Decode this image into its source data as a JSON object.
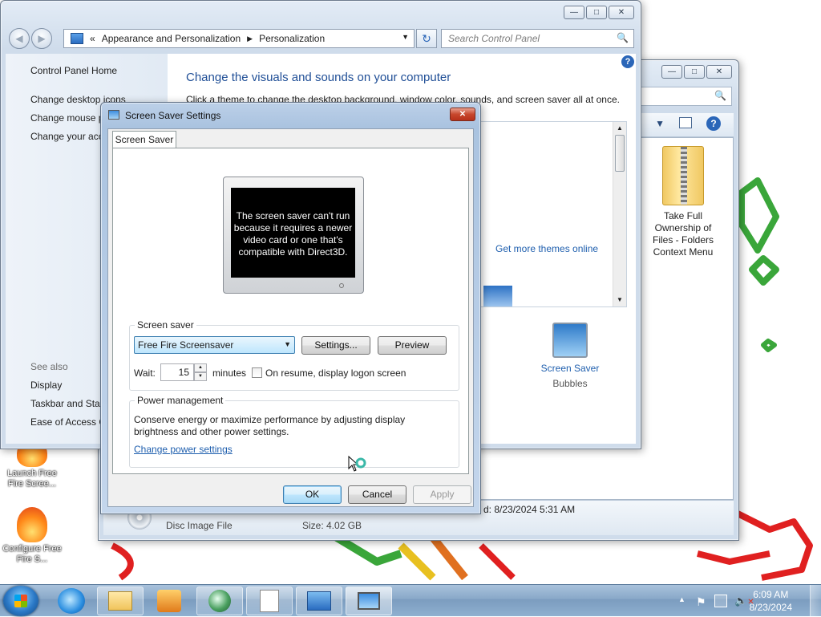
{
  "desktop": {
    "icons": [
      {
        "label": "Launch Free Fire Scree..."
      },
      {
        "label": "Configure Free Fire S..."
      }
    ]
  },
  "explorer": {
    "file_icon_label": "Take Full Ownership of Files - Folders Context Menu",
    "status_date": "d: 8/23/2024 5:31 AM",
    "file_type": "Disc Image File",
    "file_size": "Size: 4.02 GB"
  },
  "control_panel": {
    "breadcrumb_prefix": "«",
    "breadcrumb_1": "Appearance and Personalization",
    "breadcrumb_2": "Personalization",
    "search_placeholder": "Search Control Panel",
    "left_nav": {
      "home": "Control Panel Home",
      "items": [
        "Change desktop icons",
        "Change mouse p",
        "Change your acc"
      ],
      "see_also_label": "See also",
      "see_also": [
        "Display",
        "Taskbar and Star",
        "Ease of Access C"
      ]
    },
    "heading": "Change the visuals and sounds on your computer",
    "description": "Click a theme to change the desktop background, window color, sounds, and screen saver all at once.",
    "more_themes": "Get more themes online",
    "screen_saver_link": "Screen Saver",
    "screen_saver_value": "Bubbles"
  },
  "dialog": {
    "title": "Screen Saver Settings",
    "tab": "Screen Saver",
    "preview_text": "The screen saver can't run because it requires a newer video card or one that's compatible with Direct3D.",
    "screensaver_group_label": "Screen saver",
    "selected_screensaver": "Free Fire Screensaver",
    "settings_button": "Settings...",
    "preview_button": "Preview",
    "wait_label": "Wait:",
    "wait_value": "15",
    "minutes_label": "minutes",
    "resume_checkbox_label": "On resume, display logon screen",
    "resume_checked": false,
    "power_group_label": "Power management",
    "power_description": "Conserve energy or maximize performance by adjusting display brightness and other power settings.",
    "power_link": "Change power settings",
    "ok_button": "OK",
    "cancel_button": "Cancel",
    "apply_button": "Apply"
  },
  "taskbar": {
    "time": "6:09 AM",
    "date": "8/23/2024"
  }
}
